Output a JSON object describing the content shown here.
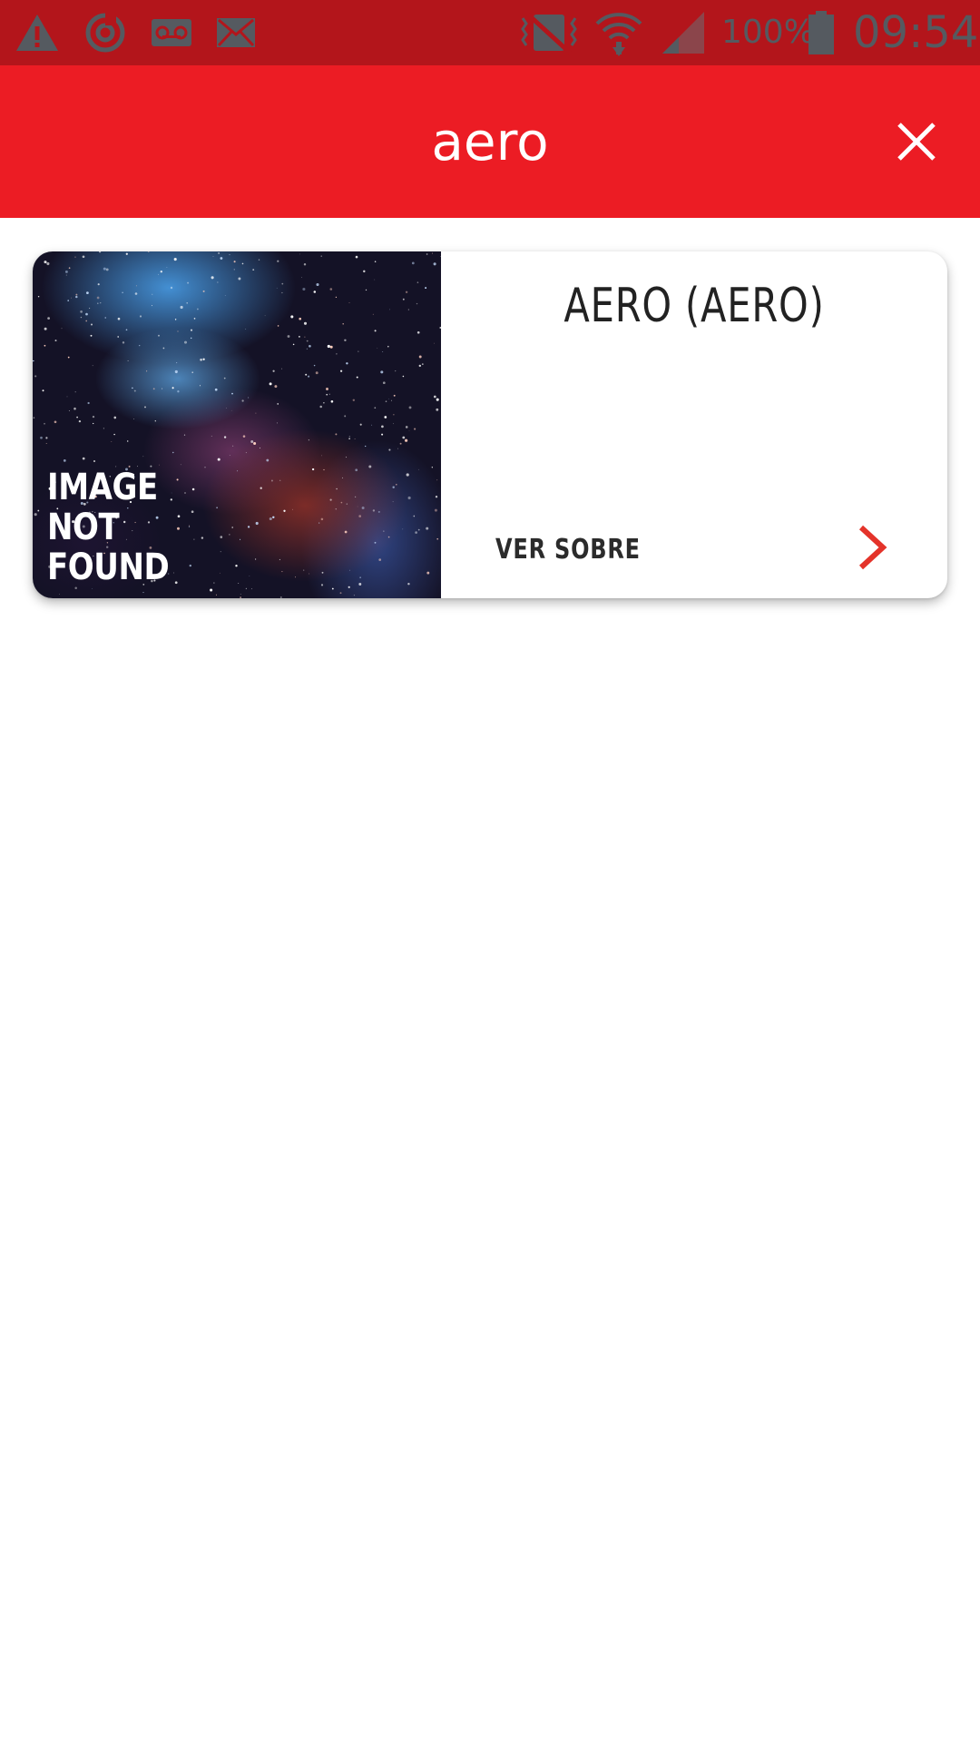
{
  "status_bar": {
    "battery": "100%",
    "time": "09:54",
    "icons_left": [
      "warning-icon",
      "sync-icon",
      "voicemail-icon",
      "mail-icon"
    ],
    "icons_right": [
      "vibrate-icon",
      "wifi-icon",
      "signal-icon",
      "battery-icon"
    ]
  },
  "app_bar": {
    "title": "aero",
    "close_icon": "close-icon"
  },
  "result_card": {
    "image_text_line1": "IMAGE",
    "image_text_line2": "NOT",
    "image_text_line3": "FOUND",
    "title": "AERO (AERO)",
    "link_label": "VER SOBRE",
    "link_icon": "chevron-right-icon"
  },
  "colors": {
    "status_bar_bg": "#b3151b",
    "app_bar_bg": "#ec1c24",
    "accent": "#e4332a",
    "text_dark": "#222222"
  }
}
